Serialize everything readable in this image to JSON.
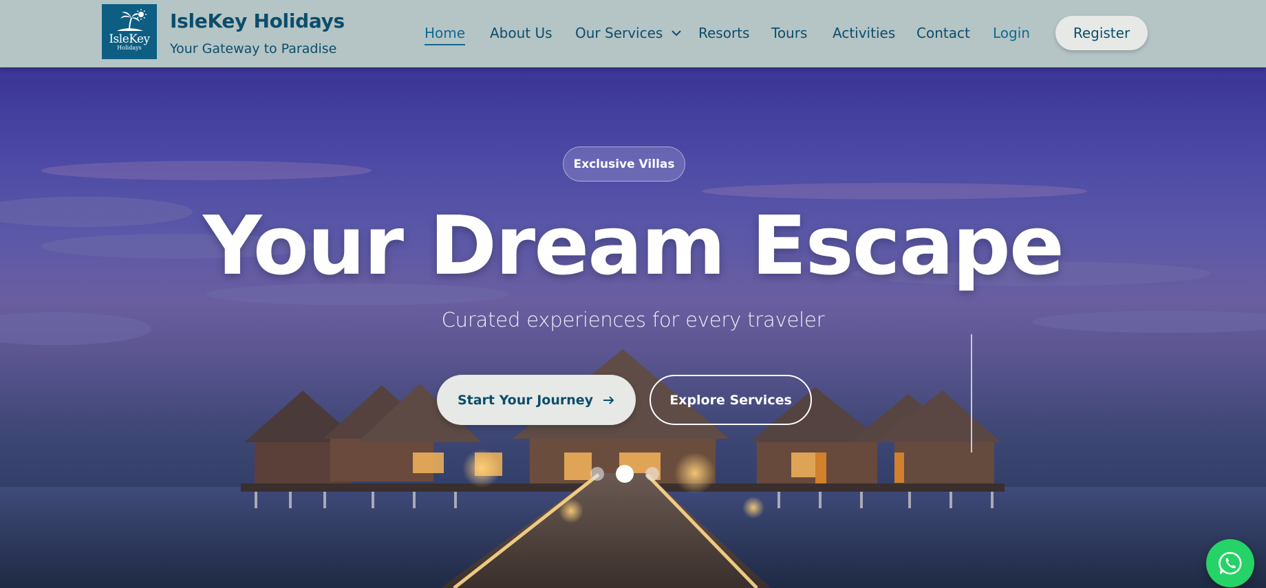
{
  "brand": {
    "logo_word": "IsleKey",
    "logo_sub": "Holidays",
    "title": "IsleKey Holidays",
    "tagline": "Your Gateway to Paradise"
  },
  "nav": {
    "items": [
      {
        "label": "Home",
        "active": true
      },
      {
        "label": "About Us"
      },
      {
        "label": "Our Services",
        "dropdown": true
      },
      {
        "label": "Resorts"
      },
      {
        "label": "Tours"
      },
      {
        "label": "Activities"
      },
      {
        "label": "Contact"
      },
      {
        "label": "Login"
      }
    ],
    "register": "Register"
  },
  "hero": {
    "badge": "Exclusive Villas",
    "title": "Your Dream Escape",
    "subtitle": "Curated experiences for every traveler",
    "primary_cta": "Start Your Journey",
    "secondary_cta": "Explore Services",
    "slides": 3,
    "active_slide": 2
  },
  "colors": {
    "header_bg": "#b5c4c5",
    "brand": "#0b4d6b",
    "logo_bg": "#0d5e82",
    "whatsapp": "#25d366"
  },
  "icons": {
    "logo": "palm-sun-icon",
    "dropdown": "chevron-down-icon",
    "cta_arrow": "arrow-right-icon",
    "chat": "whatsapp-icon"
  }
}
